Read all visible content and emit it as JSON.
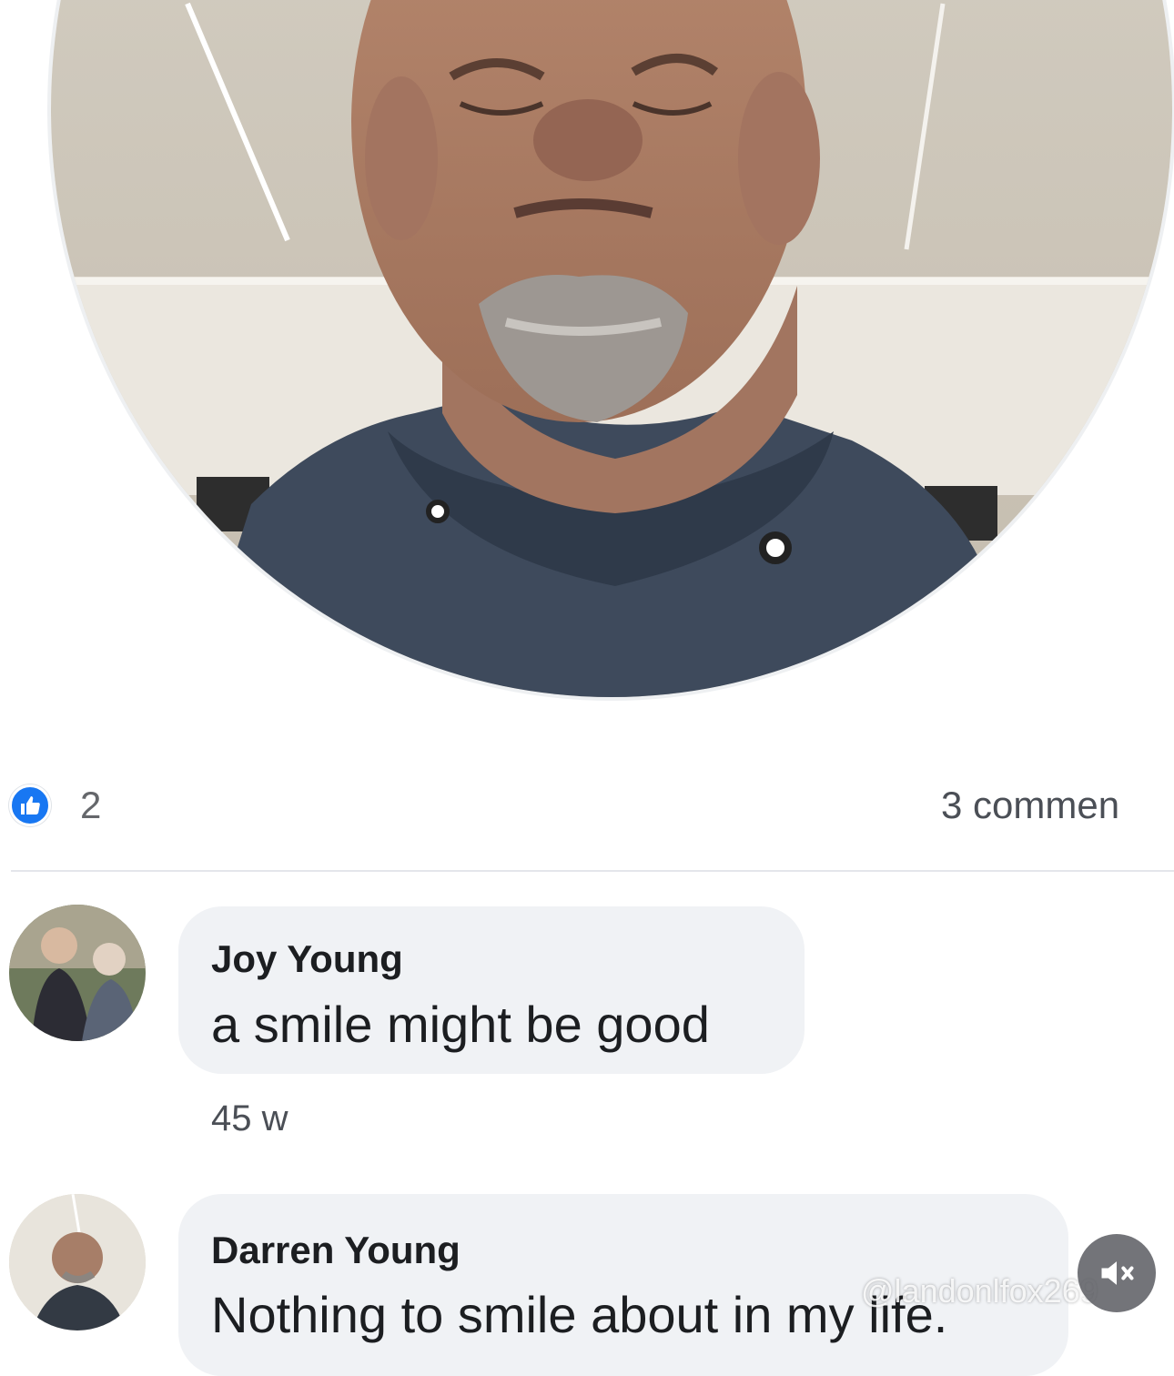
{
  "post": {
    "reactions": {
      "icon": "thumbs-up-icon",
      "count": "2",
      "color": "#1877f2"
    },
    "comments_summary": "3 commen"
  },
  "comments": [
    {
      "author": "Joy Young",
      "text": "a smile might be good",
      "time": "45 w"
    },
    {
      "author": "Darren Young",
      "text": "Nothing to smile about in my life."
    }
  ],
  "overlay": {
    "watermark": "@landonlfox269",
    "mute_icon": "speaker-muted-icon"
  }
}
